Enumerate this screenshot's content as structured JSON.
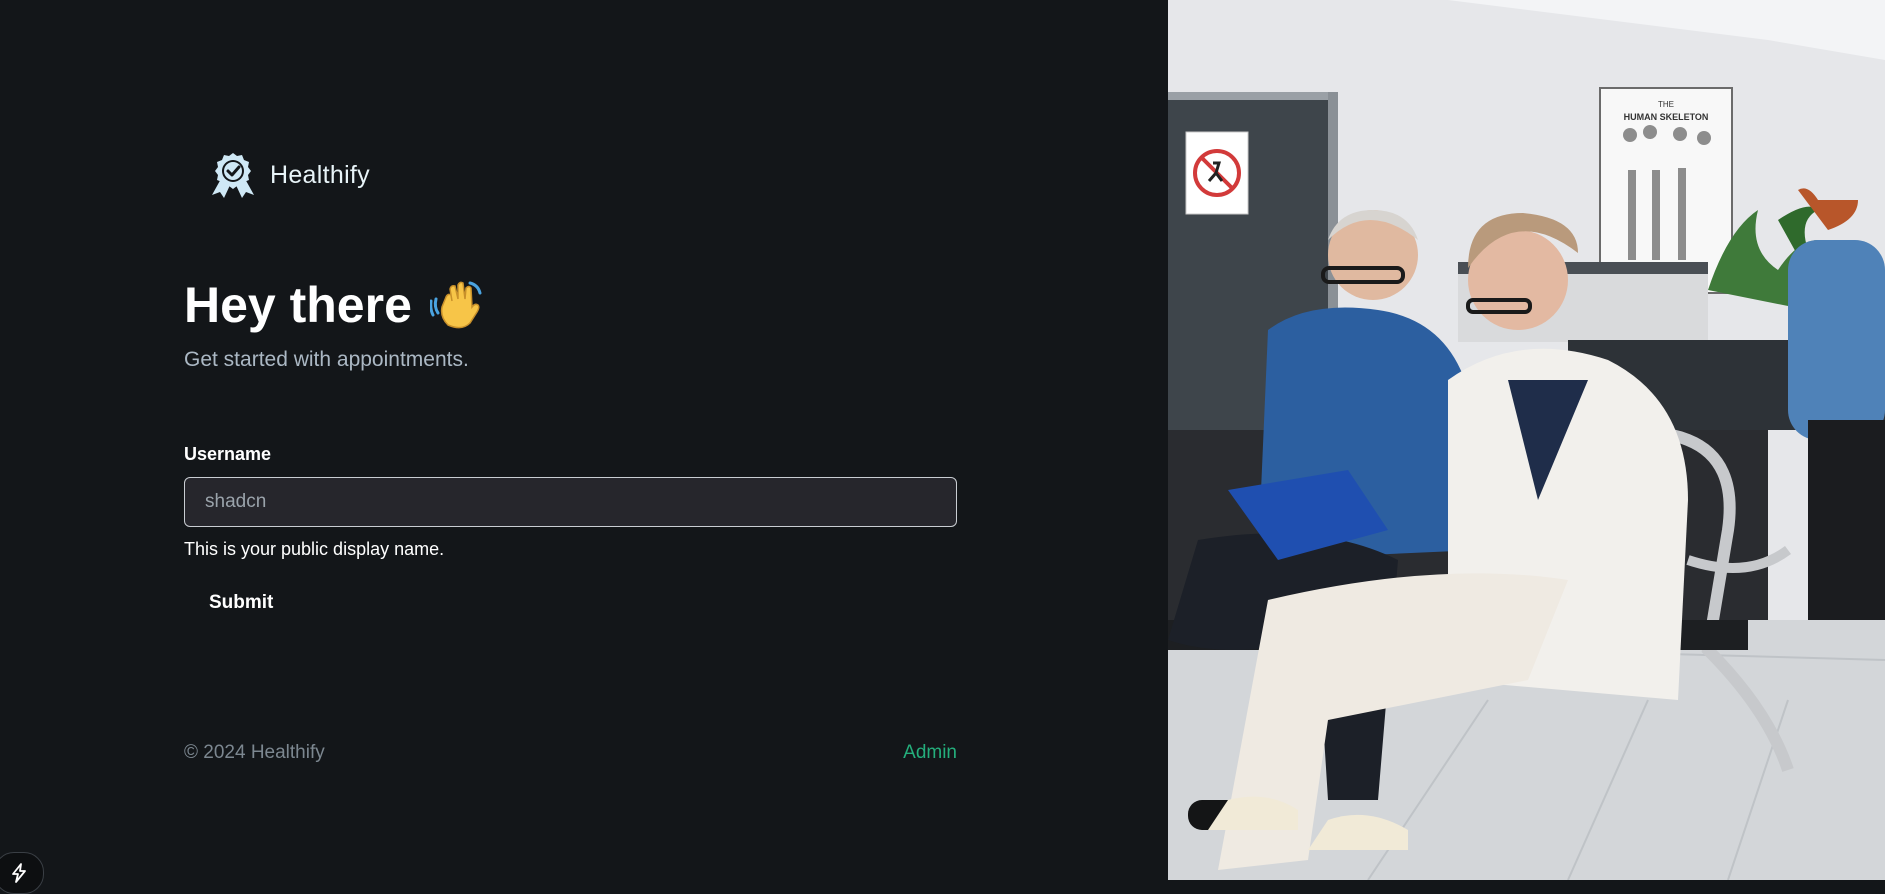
{
  "brand": {
    "name": "Healthify",
    "logo_icon": "award-badge-icon"
  },
  "hero": {
    "title": "Hey there",
    "emoji_icon": "waving-hand-icon",
    "subtitle": "Get started with appointments."
  },
  "form": {
    "username_label": "Username",
    "username_placeholder": "shadcn",
    "username_hint": "This is your public display name.",
    "submit_label": "Submit"
  },
  "footer": {
    "copyright": "© 2024 Healthify",
    "admin_link": "Admin"
  },
  "colors": {
    "background": "#131619",
    "accent_green": "#24ae7c",
    "input_bg": "#26262c"
  },
  "side_image": {
    "skeleton_poster_title": "THE",
    "skeleton_poster_subtitle": "HUMAN SKELETON"
  },
  "devtools": {
    "icon": "lightning-bolt-icon"
  }
}
